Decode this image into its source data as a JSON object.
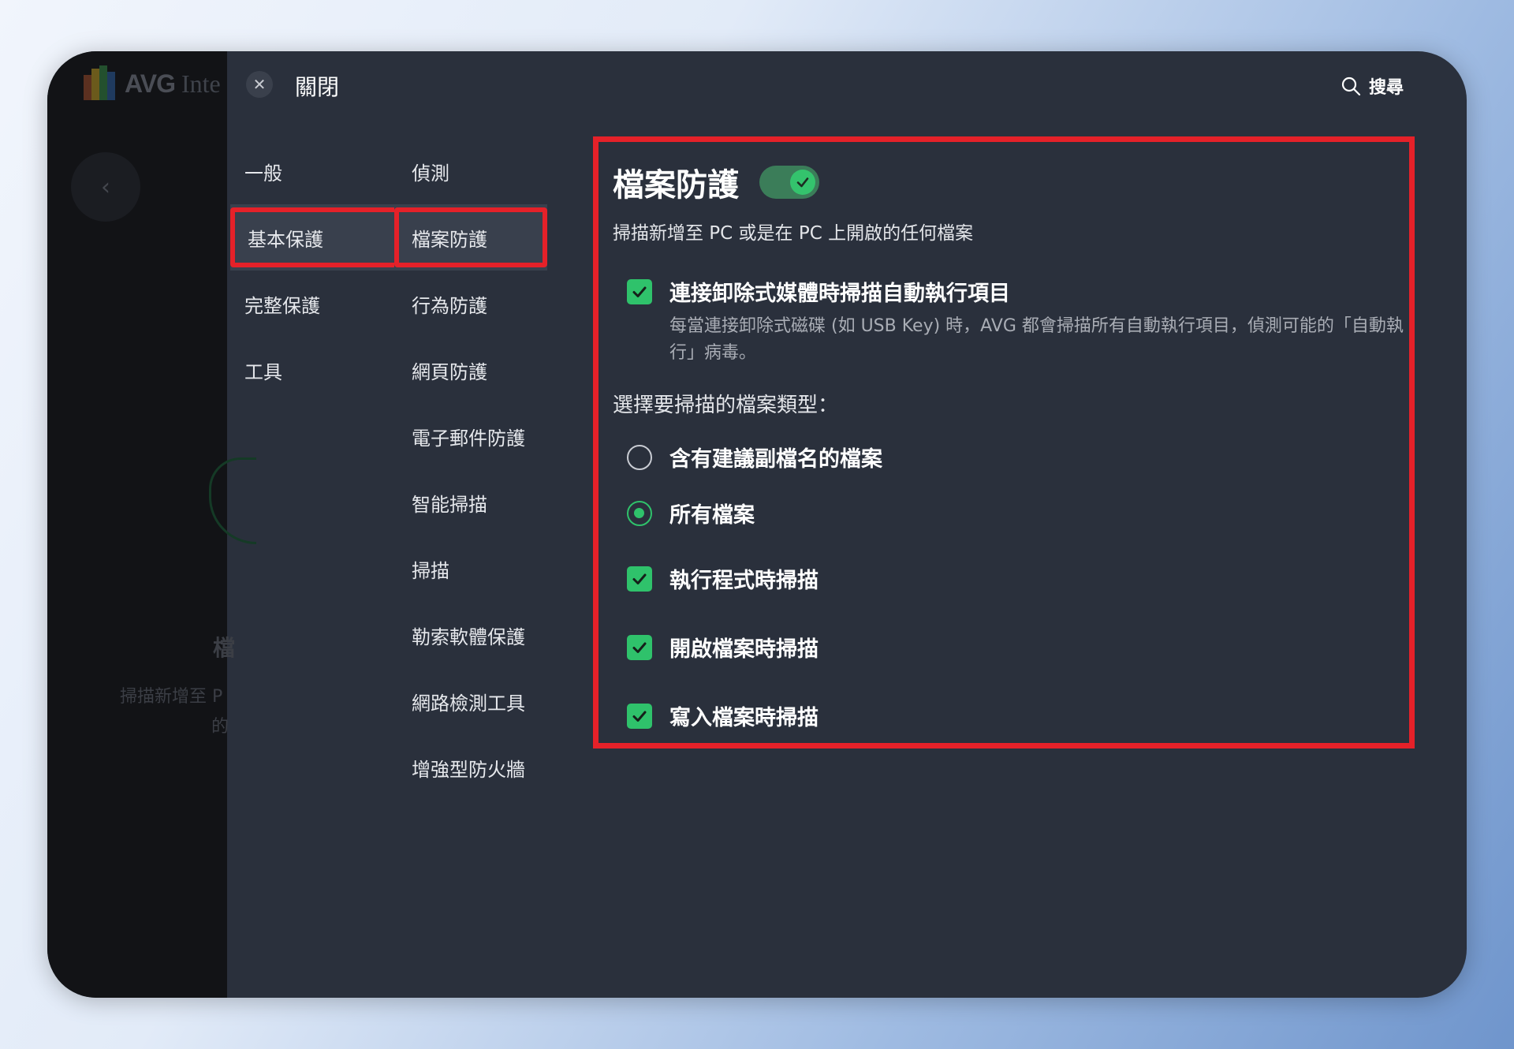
{
  "background_app": {
    "brand": "AVG",
    "brand_sub": "Inte",
    "back_icon": "chevron-left-icon",
    "text_fragment_1": "檔",
    "text_fragment_2": "掃描新增至 P",
    "text_fragment_3": "的"
  },
  "topbar": {
    "close_label": "關閉",
    "close_icon": "close-icon",
    "search_label": "搜尋",
    "search_icon": "search-icon"
  },
  "nav_primary": [
    {
      "label": "一般",
      "active": false
    },
    {
      "label": "基本保護",
      "active": true
    },
    {
      "label": "完整保護",
      "active": false
    },
    {
      "label": "工具",
      "active": false
    }
  ],
  "nav_secondary": [
    {
      "label": "偵測",
      "active": false
    },
    {
      "label": "檔案防護",
      "active": true
    },
    {
      "label": "行為防護",
      "active": false
    },
    {
      "label": "網頁防護",
      "active": false
    },
    {
      "label": "電子郵件防護",
      "active": false
    },
    {
      "label": "智能掃描",
      "active": false
    },
    {
      "label": "掃描",
      "active": false
    },
    {
      "label": "勒索軟體保護",
      "active": false
    },
    {
      "label": "網路檢測工具",
      "active": false
    },
    {
      "label": "增強型防火牆",
      "active": false
    }
  ],
  "panel": {
    "title": "檔案防護",
    "toggle_on": true,
    "description": "掃描新增至 PC 或是在 PC 上開啟的任何檔案",
    "autorun": {
      "label": "連接卸除式媒體時掃描自動執行項目",
      "checked": true,
      "description": "每當連接卸除式磁碟 (如 USB Key) 時，AVG 都會掃描所有自動執行項目，偵測可能的「自動執行」病毒。"
    },
    "file_types_label": "選擇要掃描的檔案類型：",
    "file_type_options": [
      {
        "label": "含有建議副檔名的檔案",
        "selected": false
      },
      {
        "label": "所有檔案",
        "selected": true
      }
    ],
    "scan_options": [
      {
        "label": "執行程式時掃描",
        "checked": true
      },
      {
        "label": "開啟檔案時掃描",
        "checked": true
      },
      {
        "label": "寫入檔案時掃描",
        "checked": true
      }
    ]
  },
  "colors": {
    "accent_green": "#2fc26b",
    "highlight_red": "#e52129",
    "panel_bg": "#2a303c"
  }
}
